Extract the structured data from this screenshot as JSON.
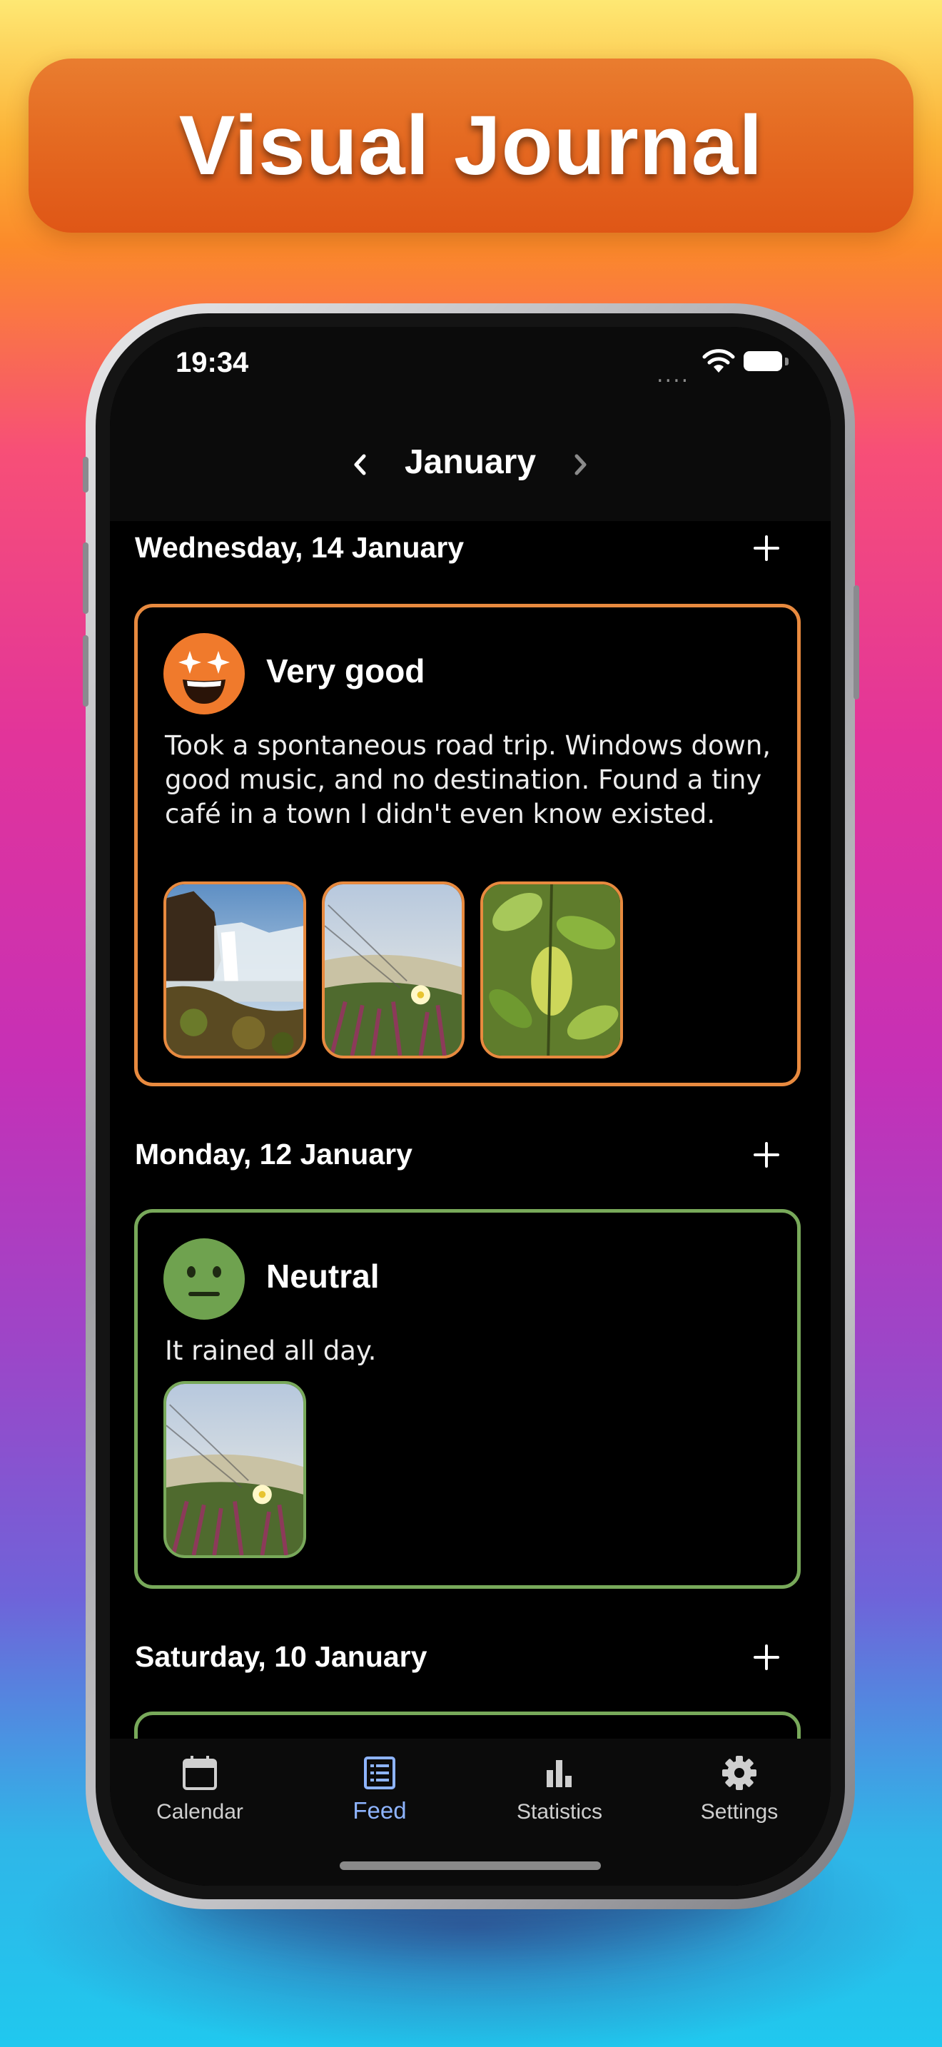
{
  "banner": {
    "title": "Visual Journal"
  },
  "status_bar": {
    "time": "19:34",
    "signal": "....",
    "wifi_icon": "wifi-icon",
    "battery_icon": "battery-icon"
  },
  "month_nav": {
    "title": "January",
    "prev_icon": "chevron-left-icon",
    "next_icon": "chevron-right-icon"
  },
  "feed": {
    "days": [
      {
        "date": "Wednesday, 14 January",
        "entry": {
          "mood": "Very good",
          "mood_icon": "star-eyes-face-icon",
          "mood_color": "#F07A2C",
          "text": "Took a spontaneous road trip. Windows down, good music, and no destination. Found a tiny café in a town I didn't even know existed.",
          "photos": [
            "waterfall-photo",
            "flower-photo",
            "leaves-photo"
          ]
        }
      },
      {
        "date": "Monday, 12 January",
        "entry": {
          "mood": "Neutral",
          "mood_icon": "neutral-face-icon",
          "mood_color": "#6FA24F",
          "text": "It rained all day.",
          "photos": [
            "flower-photo"
          ]
        }
      },
      {
        "date": "Saturday, 10 January"
      }
    ],
    "add_icon": "plus-icon"
  },
  "tab_bar": {
    "tabs": [
      {
        "label": "Calendar",
        "icon": "calendar-icon",
        "active": false
      },
      {
        "label": "Feed",
        "icon": "feed-list-icon",
        "active": true
      },
      {
        "label": "Statistics",
        "icon": "bar-chart-icon",
        "active": false
      },
      {
        "label": "Settings",
        "icon": "gear-icon",
        "active": false
      }
    ],
    "active_color": "#8EB4FF"
  }
}
